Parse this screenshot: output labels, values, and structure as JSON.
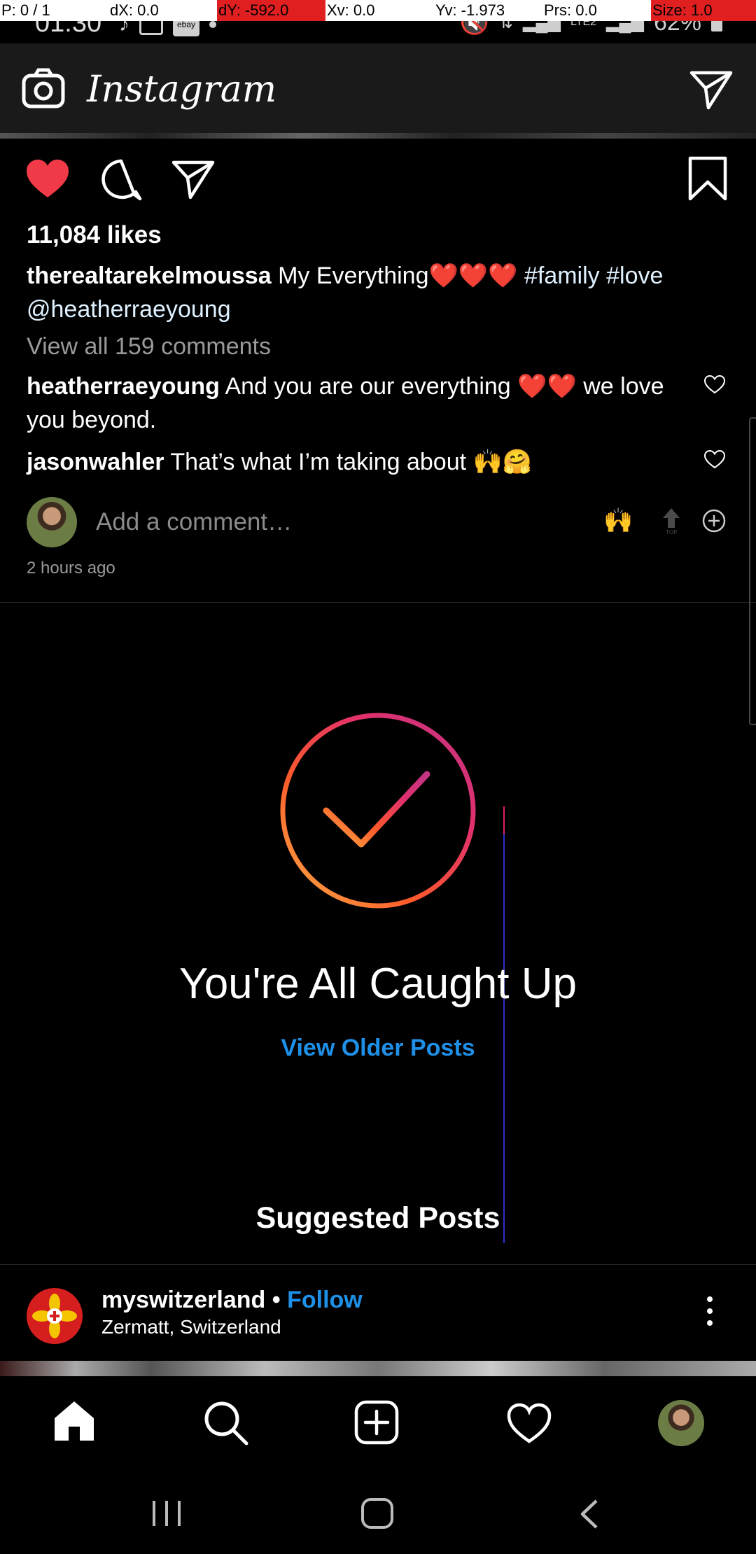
{
  "debug_overlay": [
    {
      "text": "P: 0 / 1",
      "bg": "#ffffff"
    },
    {
      "text": "dX: 0.0",
      "bg": "#ffffff"
    },
    {
      "text": "dY: -592.0",
      "bg": "#e02020"
    },
    {
      "text": "Xv: 0.0",
      "bg": "#ffffff"
    },
    {
      "text": "Yv: -1.973",
      "bg": "#ffffff"
    },
    {
      "text": "Prs: 0.0",
      "bg": "#ffffff"
    },
    {
      "text": "Size: 1.0",
      "bg": "#e02020"
    }
  ],
  "status_bar": {
    "time": "01:30",
    "battery": "62%",
    "network": "LTE2"
  },
  "header": {
    "app_title": "Instagram"
  },
  "post": {
    "likes": "11,084 likes",
    "author": "therealtarekelmoussa",
    "caption_text": "My Everything",
    "caption_emoji": "❤️❤️❤️",
    "caption_tags": "#family #love",
    "caption_mention": "@heatherraeyoung",
    "view_all": "View all 159 comments",
    "comments": [
      {
        "user": "heatherraeyoung",
        "text": "And you are our everything ❤️❤️ we love you beyond."
      },
      {
        "user": "jasonwahler",
        "text": "That’s what I’m taking about 🙌🤗"
      }
    ],
    "add_comment_placeholder": "Add a comment…",
    "quick_emoji": "🙌",
    "time_ago": "2 hours ago"
  },
  "caught_up": {
    "title": "You're All Caught Up",
    "link": "View Older Posts"
  },
  "suggested": {
    "heading": "Suggested Posts",
    "account": "myswitzerland",
    "separator": " • ",
    "follow": "Follow",
    "location": "Zermatt, Switzerland"
  },
  "colors": {
    "accent_blue": "#1e90e8",
    "like_red": "#f03a47",
    "background": "#000000"
  }
}
